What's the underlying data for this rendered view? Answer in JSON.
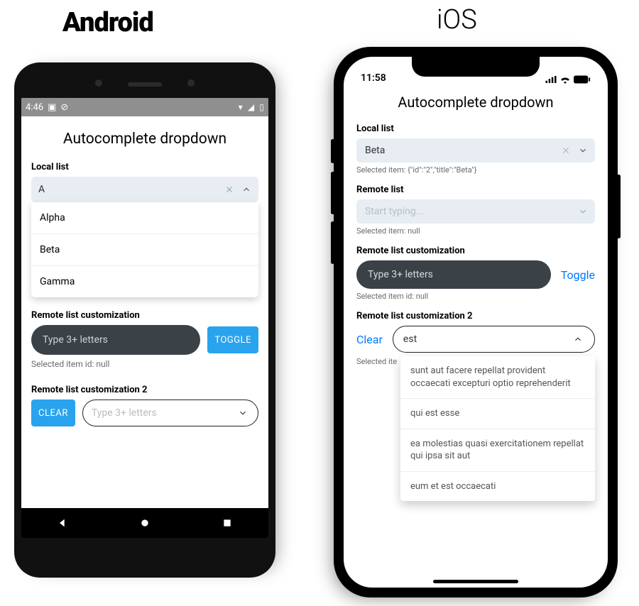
{
  "headings": {
    "android": "Android",
    "ios": "iOS"
  },
  "android": {
    "status": {
      "time": "4:46",
      "left_icons": [
        "▣",
        "⊘"
      ],
      "right_icons": [
        "▾",
        "◢",
        "▯"
      ]
    },
    "app_title": "Autocomplete dropdown",
    "local_list": {
      "label": "Local list",
      "input_value": "A",
      "options": [
        "Alpha",
        "Beta",
        "Gamma"
      ]
    },
    "remote_custom": {
      "label": "Remote list customization",
      "placeholder": "Type 3+ letters",
      "toggle_label": "TOGGLE",
      "status_text": "Selected item id: null"
    },
    "remote_custom2": {
      "label": "Remote list customization 2",
      "clear_label": "CLEAR",
      "placeholder": "Type 3+ letters"
    }
  },
  "ios": {
    "status": {
      "time": "11:58"
    },
    "app_title": "Autocomplete dropdown",
    "local_list": {
      "label": "Local list",
      "value": "Beta",
      "status_text": "Selected item: {\"id\":\"2\",\"title\":\"Beta\"}"
    },
    "remote_list": {
      "label": "Remote list",
      "placeholder": "Start typing...",
      "status_text": "Selected item: null"
    },
    "remote_custom": {
      "label": "Remote list customization",
      "placeholder": "Type 3+ letters",
      "toggle_label": "Toggle",
      "status_text": "Selected item id: null"
    },
    "remote_custom2": {
      "label": "Remote list customization 2",
      "clear_label": "Clear",
      "input_value": "est",
      "status_prefix": "Selected ite",
      "options": [
        "sunt aut facere repellat provident occaecati excepturi optio reprehenderit",
        "qui est esse",
        "ea molestias quasi exercitationem repellat qui ipsa sit aut",
        "eum et est occaecati"
      ]
    }
  }
}
